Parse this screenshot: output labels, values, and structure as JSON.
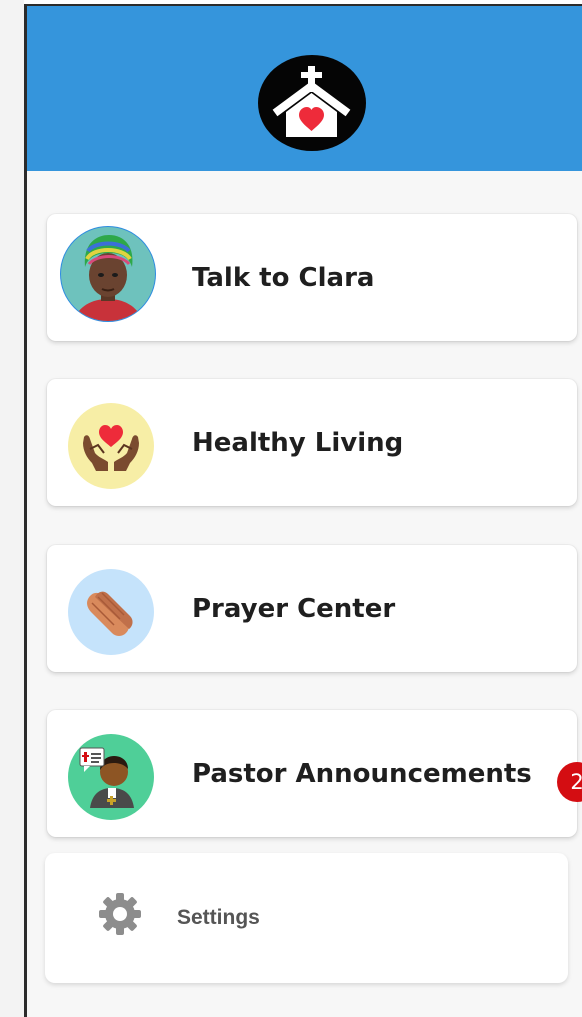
{
  "header": {
    "logo_icon": "church-heart-icon",
    "background": "#3595dc"
  },
  "menu": [
    {
      "label": "Talk to Clara",
      "icon": "clara-avatar-icon"
    },
    {
      "label": "Healthy Living",
      "icon": "heart-hands-icon",
      "icon_bg": "#f7eea6"
    },
    {
      "label": "Prayer Center",
      "icon": "praying-hands-icon",
      "icon_bg": "#c5e3fb"
    },
    {
      "label": "Pastor Announcements",
      "icon": "pastor-icon",
      "icon_bg": "#4fcf98",
      "badge": "2"
    }
  ],
  "settings": {
    "label": "Settings",
    "icon": "gear-icon"
  },
  "colors": {
    "badge": "#d40d12",
    "heart": "#ee2b3a"
  }
}
